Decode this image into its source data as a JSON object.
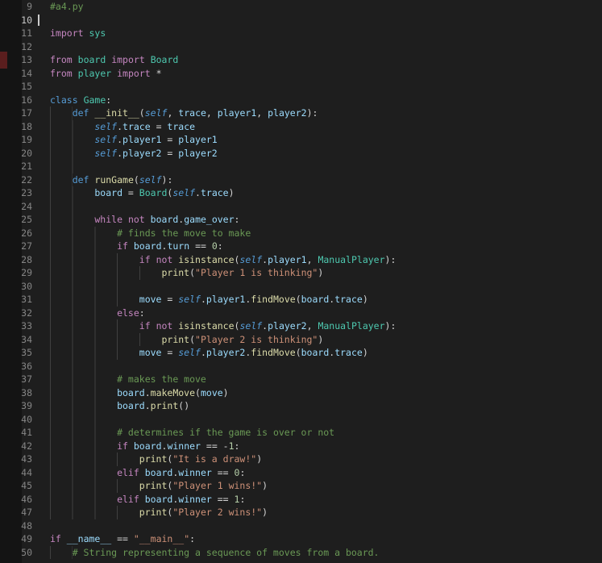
{
  "editor": {
    "active_line": 10,
    "cursor": {
      "line": 10,
      "column": 0
    },
    "colors": {
      "background": "#1e1e1e",
      "left_margin": "#141414",
      "decoration": "#5a1e1e",
      "gutter": "#858585",
      "active_gutter": "#c6c6c6",
      "comment": "#6A9955",
      "keyword": "#C586C0",
      "storage": "#569CD6",
      "function": "#DCDCAA",
      "class_name": "#4EC9B0",
      "variable": "#9CDCFE",
      "string": "#CE9178",
      "number": "#B5CEA8",
      "punctuation": "#D4D4D4",
      "indent_guide": "#404040",
      "cursor": "#cccccc"
    },
    "lines": [
      {
        "num": 9,
        "indent": 0,
        "tokens": [
          [
            "comment",
            "#a4.py"
          ]
        ]
      },
      {
        "num": 10,
        "indent": 0,
        "tokens": [],
        "cursor": true
      },
      {
        "num": 11,
        "indent": 0,
        "tokens": [
          [
            "kw",
            "import"
          ],
          [
            "p",
            " "
          ],
          [
            "cl",
            "sys"
          ]
        ]
      },
      {
        "num": 12,
        "indent": 0,
        "tokens": []
      },
      {
        "num": 13,
        "indent": 0,
        "tokens": [
          [
            "kw",
            "from"
          ],
          [
            "p",
            " "
          ],
          [
            "cl",
            "board"
          ],
          [
            "p",
            " "
          ],
          [
            "kw",
            "import"
          ],
          [
            "p",
            " "
          ],
          [
            "cl",
            "Board"
          ]
        ]
      },
      {
        "num": 14,
        "indent": 0,
        "tokens": [
          [
            "kw",
            "from"
          ],
          [
            "p",
            " "
          ],
          [
            "cl",
            "player"
          ],
          [
            "p",
            " "
          ],
          [
            "kw",
            "import"
          ],
          [
            "p",
            " *"
          ]
        ]
      },
      {
        "num": 15,
        "indent": 0,
        "tokens": []
      },
      {
        "num": 16,
        "indent": 0,
        "tokens": [
          [
            "st",
            "class"
          ],
          [
            "p",
            " "
          ],
          [
            "cl",
            "Game"
          ],
          [
            "p",
            ":"
          ]
        ]
      },
      {
        "num": 17,
        "indent": 4,
        "tokens": [
          [
            "st",
            "def"
          ],
          [
            "p",
            " "
          ],
          [
            "fn",
            "__init__"
          ],
          [
            "p",
            "("
          ],
          [
            "self",
            "self"
          ],
          [
            "p",
            ", "
          ],
          [
            "var",
            "trace"
          ],
          [
            "p",
            ", "
          ],
          [
            "var",
            "player1"
          ],
          [
            "p",
            ", "
          ],
          [
            "var",
            "player2"
          ],
          [
            "p",
            "):"
          ]
        ]
      },
      {
        "num": 18,
        "indent": 8,
        "tokens": [
          [
            "self",
            "self"
          ],
          [
            "p",
            "."
          ],
          [
            "var",
            "trace"
          ],
          [
            "p",
            " = "
          ],
          [
            "var",
            "trace"
          ]
        ]
      },
      {
        "num": 19,
        "indent": 8,
        "tokens": [
          [
            "self",
            "self"
          ],
          [
            "p",
            "."
          ],
          [
            "var",
            "player1"
          ],
          [
            "p",
            " = "
          ],
          [
            "var",
            "player1"
          ]
        ]
      },
      {
        "num": 20,
        "indent": 8,
        "tokens": [
          [
            "self",
            "self"
          ],
          [
            "p",
            "."
          ],
          [
            "var",
            "player2"
          ],
          [
            "p",
            " = "
          ],
          [
            "var",
            "player2"
          ]
        ]
      },
      {
        "num": 21,
        "indent": 8,
        "tokens": []
      },
      {
        "num": 22,
        "indent": 4,
        "tokens": [
          [
            "st",
            "def"
          ],
          [
            "p",
            " "
          ],
          [
            "fn",
            "runGame"
          ],
          [
            "p",
            "("
          ],
          [
            "self",
            "self"
          ],
          [
            "p",
            "):"
          ]
        ]
      },
      {
        "num": 23,
        "indent": 8,
        "tokens": [
          [
            "var",
            "board"
          ],
          [
            "p",
            " = "
          ],
          [
            "cl",
            "Board"
          ],
          [
            "p",
            "("
          ],
          [
            "self",
            "self"
          ],
          [
            "p",
            "."
          ],
          [
            "var",
            "trace"
          ],
          [
            "p",
            ")"
          ]
        ]
      },
      {
        "num": 24,
        "indent": 8,
        "tokens": []
      },
      {
        "num": 25,
        "indent": 8,
        "tokens": [
          [
            "kw",
            "while"
          ],
          [
            "p",
            " "
          ],
          [
            "kw",
            "not"
          ],
          [
            "p",
            " "
          ],
          [
            "var",
            "board"
          ],
          [
            "p",
            "."
          ],
          [
            "var",
            "game_over"
          ],
          [
            "p",
            ":"
          ]
        ]
      },
      {
        "num": 26,
        "indent": 12,
        "tokens": [
          [
            "comment",
            "# finds the move to make"
          ]
        ]
      },
      {
        "num": 27,
        "indent": 12,
        "tokens": [
          [
            "kw",
            "if"
          ],
          [
            "p",
            " "
          ],
          [
            "var",
            "board"
          ],
          [
            "p",
            "."
          ],
          [
            "var",
            "turn"
          ],
          [
            "p",
            " == "
          ],
          [
            "num",
            "0"
          ],
          [
            "p",
            ":"
          ]
        ]
      },
      {
        "num": 28,
        "indent": 16,
        "tokens": [
          [
            "kw",
            "if"
          ],
          [
            "p",
            " "
          ],
          [
            "kw",
            "not"
          ],
          [
            "p",
            " "
          ],
          [
            "fn",
            "isinstance"
          ],
          [
            "p",
            "("
          ],
          [
            "self",
            "self"
          ],
          [
            "p",
            "."
          ],
          [
            "var",
            "player1"
          ],
          [
            "p",
            ", "
          ],
          [
            "cl",
            "ManualPlayer"
          ],
          [
            "p",
            "):"
          ]
        ]
      },
      {
        "num": 29,
        "indent": 20,
        "tokens": [
          [
            "fn",
            "print"
          ],
          [
            "p",
            "("
          ],
          [
            "str",
            "\"Player 1 is thinking\""
          ],
          [
            "p",
            ")"
          ]
        ]
      },
      {
        "num": 30,
        "indent": 16,
        "tokens": []
      },
      {
        "num": 31,
        "indent": 16,
        "tokens": [
          [
            "var",
            "move"
          ],
          [
            "p",
            " = "
          ],
          [
            "self",
            "self"
          ],
          [
            "p",
            "."
          ],
          [
            "var",
            "player1"
          ],
          [
            "p",
            "."
          ],
          [
            "fn",
            "findMove"
          ],
          [
            "p",
            "("
          ],
          [
            "var",
            "board"
          ],
          [
            "p",
            "."
          ],
          [
            "var",
            "trace"
          ],
          [
            "p",
            ")"
          ]
        ]
      },
      {
        "num": 32,
        "indent": 12,
        "tokens": [
          [
            "kw",
            "else"
          ],
          [
            "p",
            ":"
          ]
        ]
      },
      {
        "num": 33,
        "indent": 16,
        "tokens": [
          [
            "kw",
            "if"
          ],
          [
            "p",
            " "
          ],
          [
            "kw",
            "not"
          ],
          [
            "p",
            " "
          ],
          [
            "fn",
            "isinstance"
          ],
          [
            "p",
            "("
          ],
          [
            "self",
            "self"
          ],
          [
            "p",
            "."
          ],
          [
            "var",
            "player2"
          ],
          [
            "p",
            ", "
          ],
          [
            "cl",
            "ManualPlayer"
          ],
          [
            "p",
            "):"
          ]
        ]
      },
      {
        "num": 34,
        "indent": 20,
        "tokens": [
          [
            "fn",
            "print"
          ],
          [
            "p",
            "("
          ],
          [
            "str",
            "\"Player 2 is thinking\""
          ],
          [
            "p",
            ")"
          ]
        ]
      },
      {
        "num": 35,
        "indent": 16,
        "tokens": [
          [
            "var",
            "move"
          ],
          [
            "p",
            " = "
          ],
          [
            "self",
            "self"
          ],
          [
            "p",
            "."
          ],
          [
            "var",
            "player2"
          ],
          [
            "p",
            "."
          ],
          [
            "fn",
            "findMove"
          ],
          [
            "p",
            "("
          ],
          [
            "var",
            "board"
          ],
          [
            "p",
            "."
          ],
          [
            "var",
            "trace"
          ],
          [
            "p",
            ")"
          ]
        ]
      },
      {
        "num": 36,
        "indent": 12,
        "tokens": []
      },
      {
        "num": 37,
        "indent": 12,
        "tokens": [
          [
            "comment",
            "# makes the move"
          ]
        ]
      },
      {
        "num": 38,
        "indent": 12,
        "tokens": [
          [
            "var",
            "board"
          ],
          [
            "p",
            "."
          ],
          [
            "fn",
            "makeMove"
          ],
          [
            "p",
            "("
          ],
          [
            "var",
            "move"
          ],
          [
            "p",
            ")"
          ]
        ]
      },
      {
        "num": 39,
        "indent": 12,
        "tokens": [
          [
            "var",
            "board"
          ],
          [
            "p",
            "."
          ],
          [
            "fn",
            "print"
          ],
          [
            "p",
            "()"
          ]
        ]
      },
      {
        "num": 40,
        "indent": 12,
        "tokens": []
      },
      {
        "num": 41,
        "indent": 12,
        "tokens": [
          [
            "comment",
            "# determines if the game is over or not"
          ]
        ]
      },
      {
        "num": 42,
        "indent": 12,
        "tokens": [
          [
            "kw",
            "if"
          ],
          [
            "p",
            " "
          ],
          [
            "var",
            "board"
          ],
          [
            "p",
            "."
          ],
          [
            "var",
            "winner"
          ],
          [
            "p",
            " == -"
          ],
          [
            "num",
            "1"
          ],
          [
            "p",
            ":"
          ]
        ]
      },
      {
        "num": 43,
        "indent": 16,
        "tokens": [
          [
            "fn",
            "print"
          ],
          [
            "p",
            "("
          ],
          [
            "str",
            "\"It is a draw!\""
          ],
          [
            "p",
            ")"
          ]
        ]
      },
      {
        "num": 44,
        "indent": 12,
        "tokens": [
          [
            "kw",
            "elif"
          ],
          [
            "p",
            " "
          ],
          [
            "var",
            "board"
          ],
          [
            "p",
            "."
          ],
          [
            "var",
            "winner"
          ],
          [
            "p",
            " == "
          ],
          [
            "num",
            "0"
          ],
          [
            "p",
            ":"
          ]
        ]
      },
      {
        "num": 45,
        "indent": 16,
        "tokens": [
          [
            "fn",
            "print"
          ],
          [
            "p",
            "("
          ],
          [
            "str",
            "\"Player 1 wins!\""
          ],
          [
            "p",
            ")"
          ]
        ]
      },
      {
        "num": 46,
        "indent": 12,
        "tokens": [
          [
            "kw",
            "elif"
          ],
          [
            "p",
            " "
          ],
          [
            "var",
            "board"
          ],
          [
            "p",
            "."
          ],
          [
            "var",
            "winner"
          ],
          [
            "p",
            " == "
          ],
          [
            "num",
            "1"
          ],
          [
            "p",
            ":"
          ]
        ]
      },
      {
        "num": 47,
        "indent": 16,
        "tokens": [
          [
            "fn",
            "print"
          ],
          [
            "p",
            "("
          ],
          [
            "str",
            "\"Player 2 wins!\""
          ],
          [
            "p",
            ")"
          ]
        ]
      },
      {
        "num": 48,
        "indent": 0,
        "tokens": []
      },
      {
        "num": 49,
        "indent": 0,
        "tokens": [
          [
            "kw",
            "if"
          ],
          [
            "p",
            " "
          ],
          [
            "var",
            "__name__"
          ],
          [
            "p",
            " == "
          ],
          [
            "str",
            "\"__main__\""
          ],
          [
            "p",
            ":"
          ]
        ]
      },
      {
        "num": 50,
        "indent": 4,
        "tokens": [
          [
            "comment",
            "# String representing a sequence of moves from a board."
          ]
        ]
      }
    ]
  }
}
